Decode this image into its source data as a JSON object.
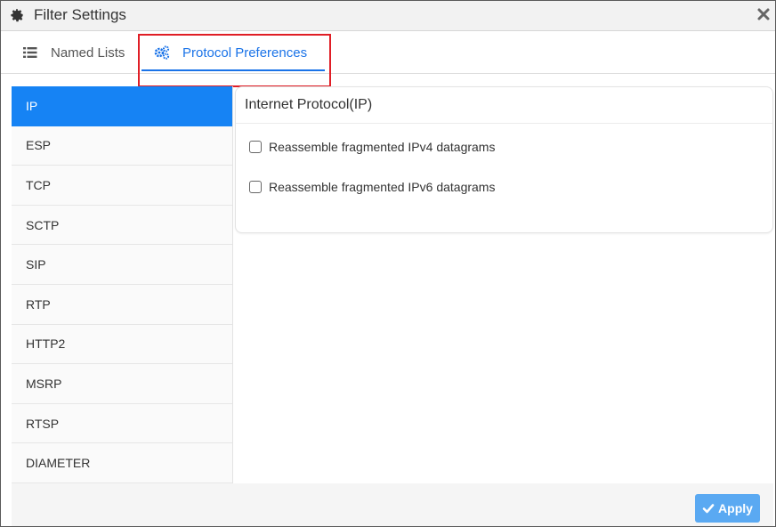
{
  "dialog": {
    "title": "Filter Settings",
    "title_icon": "gear-icon",
    "close_icon": "close-icon"
  },
  "tabs": [
    {
      "label": "Named Lists",
      "icon": "list-icon",
      "active": false
    },
    {
      "label": "Protocol Preferences",
      "icon": "cogs-icon",
      "active": true
    }
  ],
  "sidebar": {
    "items": [
      {
        "label": "IP",
        "active": true
      },
      {
        "label": "ESP"
      },
      {
        "label": "TCP"
      },
      {
        "label": "SCTP"
      },
      {
        "label": "SIP"
      },
      {
        "label": "RTP"
      },
      {
        "label": "HTTP2"
      },
      {
        "label": "MSRP"
      },
      {
        "label": "RTSP"
      },
      {
        "label": "DIAMETER"
      }
    ]
  },
  "panel": {
    "title": "Internet Protocol(IP)",
    "options": [
      {
        "label": "Reassemble fragmented IPv4 datagrams",
        "checked": false
      },
      {
        "label": "Reassemble fragmented IPv6 datagrams",
        "checked": false
      }
    ]
  },
  "footer": {
    "apply_label": "Apply",
    "apply_icon": "check-icon"
  },
  "colors": {
    "accent": "#1683f4",
    "tab_active": "#1a73e8",
    "highlight": "#e01e26",
    "apply_button": "#5aa9f2"
  }
}
